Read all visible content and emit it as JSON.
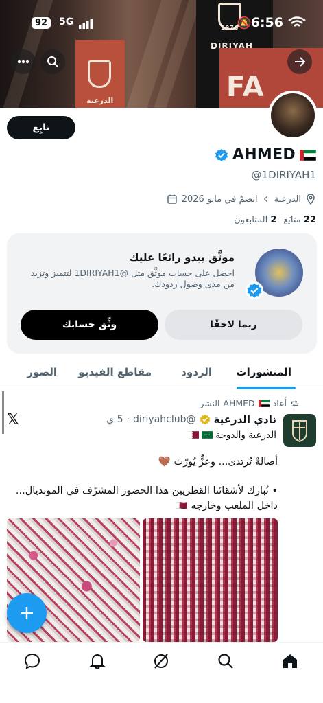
{
  "status_bar": {
    "time": "6:56",
    "battery": "92",
    "network": "5G"
  },
  "profile": {
    "follow_label": "تابِع",
    "name": "AHMED",
    "handle": "@1DIRIYAH1",
    "location": "الدرعية",
    "joined": "انضمّ في مايو 2026",
    "following_count": "22",
    "following_label": "متابَع",
    "followers_count": "2",
    "followers_label": "المتابعون"
  },
  "verify_card": {
    "title": "موثَّق يبدو رائعًا عليك",
    "description": "احصل على حساب موثَّق مثل @1DIRIYAH1 لتتميز وتزيد من مدى وصول ردودك.",
    "later_label": "ربما لاحقًا",
    "verify_label": "وثِّق حسابك"
  },
  "tabs": [
    {
      "label": "المنشورات",
      "active": true
    },
    {
      "label": "الردود",
      "active": false
    },
    {
      "label": "مقاطع الفيديو",
      "active": false
    },
    {
      "label": "الصور",
      "active": false
    }
  ],
  "post": {
    "repost_by": "AHMED",
    "repost_label": "أعاد",
    "repost_suffix": "النشر",
    "author_name": "نادي الدرعية",
    "author_handle": "@diriyahclub",
    "time": "5 ي",
    "subtitle": "الدرعية والدوحة",
    "text1": "أصالةٌ تُرتدى... وعزٌّ يُورّث 🤎",
    "text2": "• نُبارك لأشقائنا القطريين هذا الحضور المشرّف في المونديال... داخل الملعب وخارجه 🇶🇦"
  },
  "banner": {
    "text1": "DIRIYAH",
    "text2": "الدرعية",
    "text3": "FA",
    "text4": "1976"
  },
  "colors": {
    "accent": "#1d9bf0",
    "text": "#0f1419",
    "muted": "#536471"
  },
  "icons": [
    "more-icon",
    "search-icon",
    "back-arrow-icon",
    "verified-badge-icon",
    "location-icon",
    "calendar-icon",
    "chevron-icon",
    "repost-icon",
    "x-logo-icon",
    "plus-icon",
    "home-icon",
    "search-nav-icon",
    "grok-icon",
    "notifications-icon",
    "messages-icon"
  ]
}
